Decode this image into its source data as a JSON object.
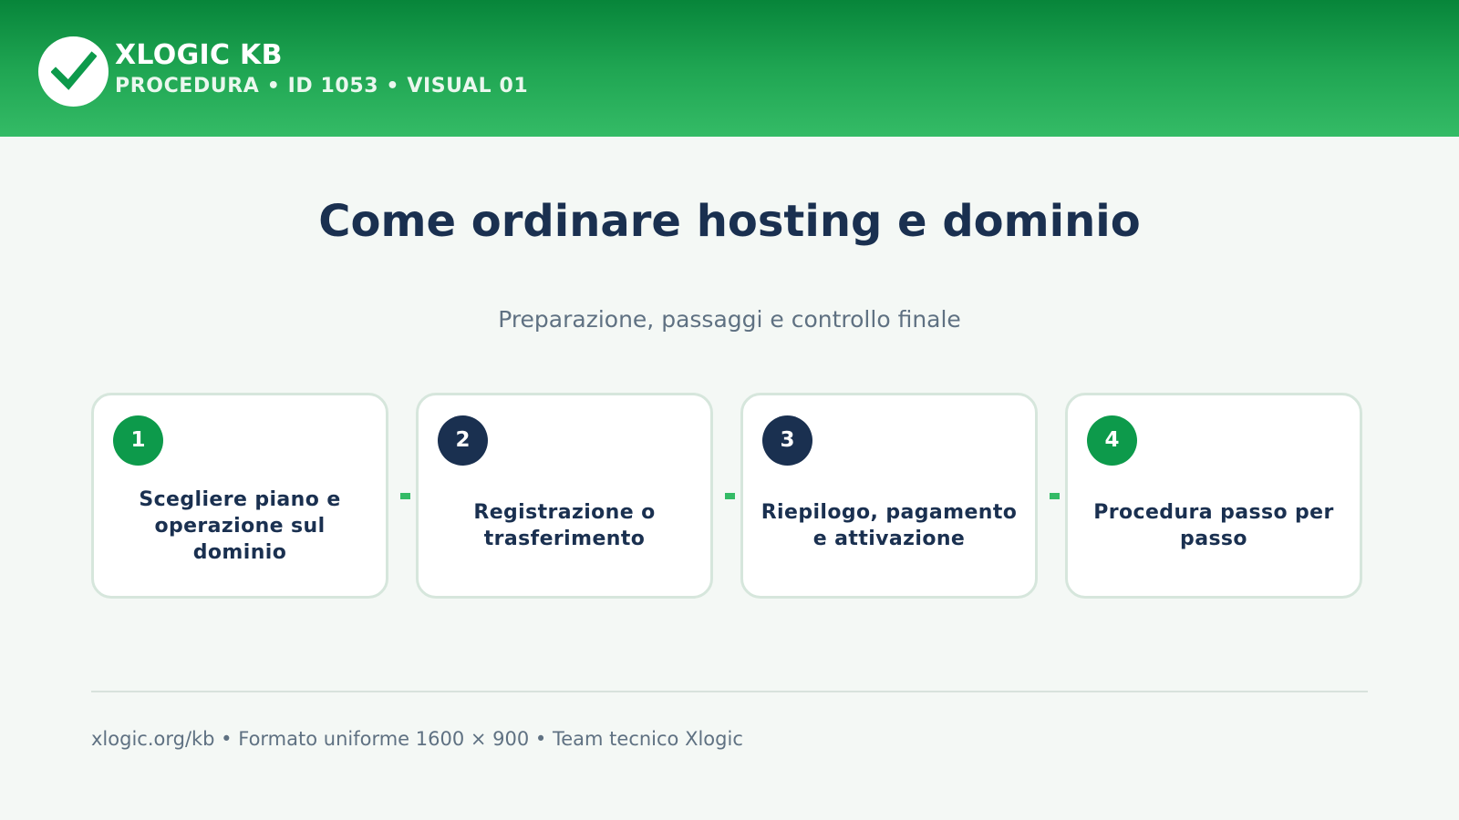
{
  "header": {
    "logo_icon": "checkmark-icon",
    "brand": "XLOGIC KB",
    "subtitle": "PROCEDURA • ID 1053 • VISUAL 01",
    "colors": {
      "gradient_top": "#07853a",
      "gradient_bottom": "#34bb66"
    }
  },
  "main": {
    "title": "Come ordinare hosting e dominio",
    "subtitle": "Preparazione, passaggi e controllo finale",
    "steps": [
      {
        "number": "1",
        "label": "Scegliere piano e operazione sul dominio",
        "badge_color": "#0d9a4b"
      },
      {
        "number": "2",
        "label": "Registrazione o trasferimento",
        "badge_color": "#1a3050"
      },
      {
        "number": "3",
        "label": "Riepilogo, pagamento e attivazione",
        "badge_color": "#1a3050"
      },
      {
        "number": "4",
        "label": "Procedura passo per passo",
        "badge_color": "#0d9a4b"
      }
    ]
  },
  "footer": {
    "text": "xlogic.org/kb • Formato uniforme 1600 × 900 • Team tecnico Xlogic"
  }
}
